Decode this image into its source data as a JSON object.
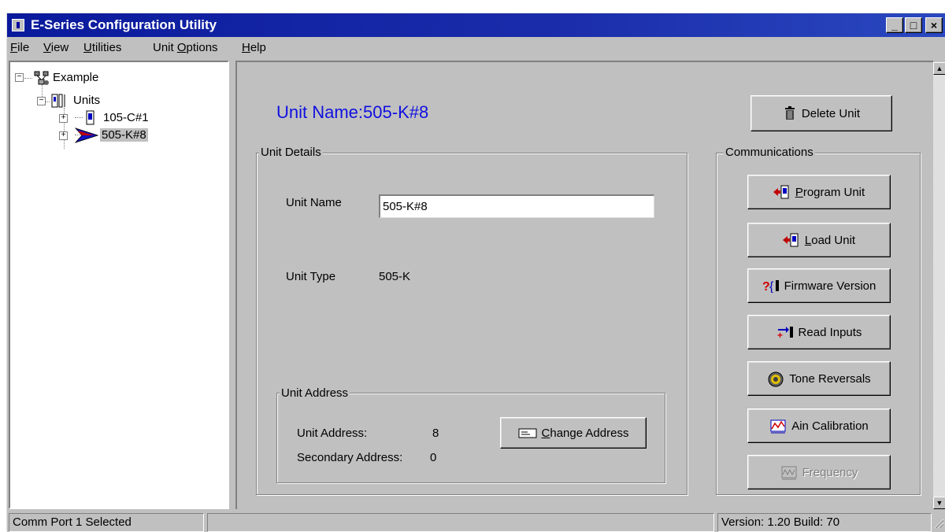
{
  "window": {
    "title": "E-Series Configuration Utility",
    "controls": {
      "minimize": "_",
      "maximize": "□",
      "close": "×"
    }
  },
  "menu": {
    "items": [
      {
        "label": "File",
        "accel": "F",
        "rest": "ile"
      },
      {
        "label": "View",
        "accel": "V",
        "rest": "iew"
      },
      {
        "label": "Utilities",
        "accel": "U",
        "rest": "tilities"
      },
      {
        "label": "Unit Options",
        "pre": "Unit ",
        "accel": "O",
        "rest": "ptions"
      },
      {
        "label": "Help",
        "accel": "H",
        "rest": "elp"
      }
    ]
  },
  "tree": {
    "root": {
      "label": "Example",
      "icon": "network-icon",
      "expander": "−"
    },
    "units": {
      "label": "Units",
      "icon": "units-folder-icon",
      "expander": "−"
    },
    "children": [
      {
        "label": "105-C#1",
        "icon": "device-icon",
        "expander": "+"
      },
      {
        "label": "505-K#8",
        "icon": "arrow-icon",
        "expander": "+",
        "selected": true
      }
    ]
  },
  "main": {
    "heading": "Unit Name:505-K#8",
    "unit_details": {
      "group_label": "Unit Details",
      "name_label": "Unit Name",
      "name_value": "505-K#8",
      "type_label": "Unit Type",
      "type_value": "505-K"
    },
    "unit_address": {
      "group_label": "Unit Address",
      "address_label": "Unit Address:",
      "address_value": "8",
      "secondary_label": "Secondary Address:",
      "secondary_value": "0",
      "change_button": {
        "accel": "C",
        "rest": "hange Address"
      }
    },
    "delete_button": "Delete Unit",
    "communications": {
      "group_label": "Communications",
      "buttons": [
        {
          "accel": "P",
          "rest": "rogram Unit",
          "icon": "program-unit-icon",
          "enabled": true
        },
        {
          "accel": "L",
          "rest": "oad Unit",
          "icon": "load-unit-icon",
          "enabled": true
        },
        {
          "label": "Firmware Version",
          "icon": "firmware-icon",
          "enabled": true
        },
        {
          "label": "Read Inputs",
          "icon": "read-inputs-icon",
          "enabled": true
        },
        {
          "label": "Tone Reversals",
          "icon": "tone-icon",
          "enabled": true
        },
        {
          "label": "Ain Calibration",
          "icon": "calibration-icon",
          "enabled": true
        },
        {
          "label": "Frequency",
          "icon": "frequency-icon",
          "enabled": false
        }
      ]
    }
  },
  "status": {
    "left": "Comm Port 1 Selected",
    "middle": "",
    "right": "Version: 1.20 Build: 70"
  },
  "colors": {
    "titlebar": "#0a1a9c",
    "heading": "#1010e0",
    "face": "#c0c0c0"
  }
}
